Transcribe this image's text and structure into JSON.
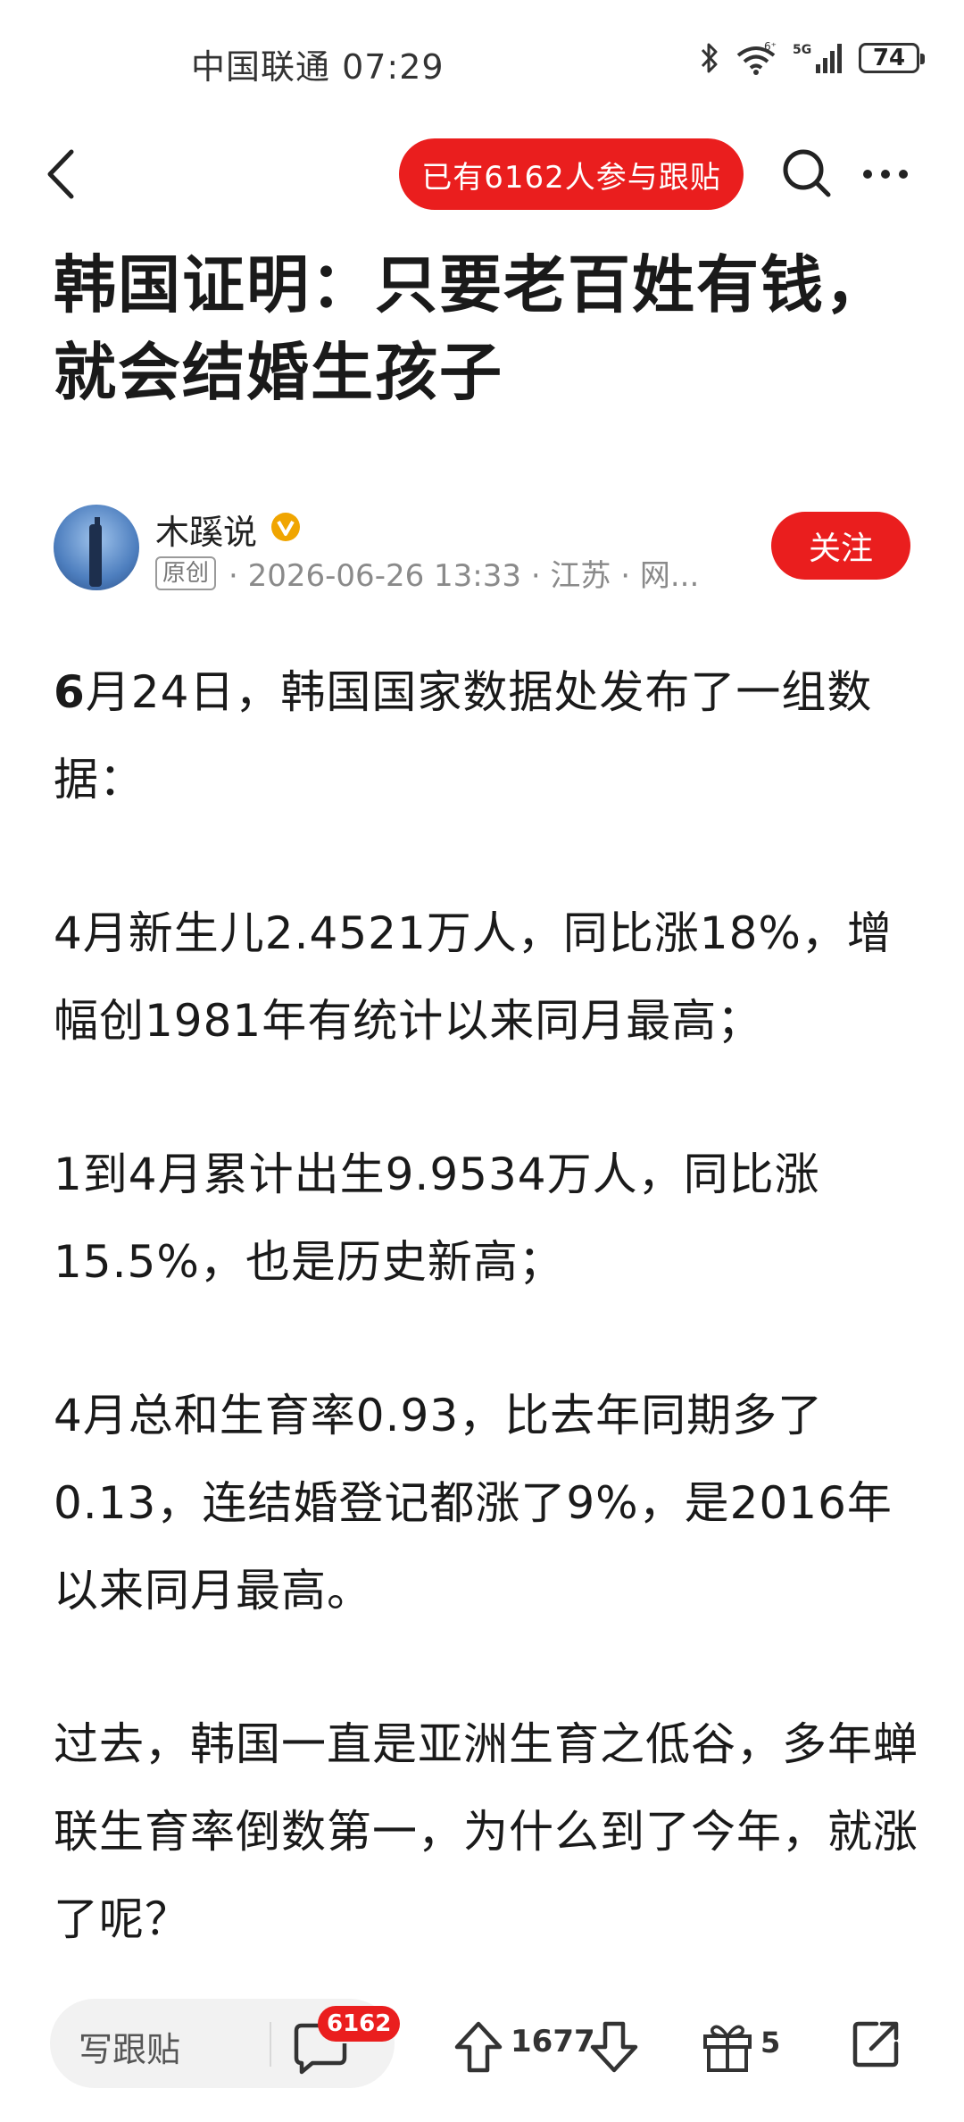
{
  "status_bar": {
    "carrier_time": "中国联通 07:29",
    "network_badge": "6⁺",
    "network_type": "5G",
    "battery": "74"
  },
  "nav": {
    "followers_pill": "已有6162人参与跟贴"
  },
  "article": {
    "title": "韩国证明：只要老百姓有钱，就会结婚生孩子",
    "author": {
      "name": "木蹊说",
      "badge": "原创",
      "meta": "· 2026-06-26 13:33 · 江苏 · 网..."
    },
    "follow_label": "关注",
    "paragraphs": [
      {
        "lead": "6",
        "text": "月24日，韩国国家数据处发布了一组数据："
      },
      {
        "lead": "",
        "text": "4月新生儿2.4521万人，同比涨18%，增幅创1981年有统计以来同月最高；"
      },
      {
        "lead": "",
        "text": "1到4月累计出生9.9534万人，同比涨15.5%，也是历史新高；"
      },
      {
        "lead": "",
        "text": "4月总和生育率0.93，比去年同期多了0.13，连结婚登记都涨了9%，是2016年以来同月最高。"
      },
      {
        "lead": "",
        "text": "过去，韩国一直是亚洲生育之低谷，多年蝉联生育率倒数第一，为什么到了今年，就涨了呢？"
      }
    ]
  },
  "bottom_bar": {
    "comment_placeholder": "写跟贴",
    "comment_count": "6162",
    "vote_count": "1677",
    "gift_count": "5"
  },
  "colors": {
    "accent": "#ea1e1e",
    "verified": "#f0a500"
  }
}
